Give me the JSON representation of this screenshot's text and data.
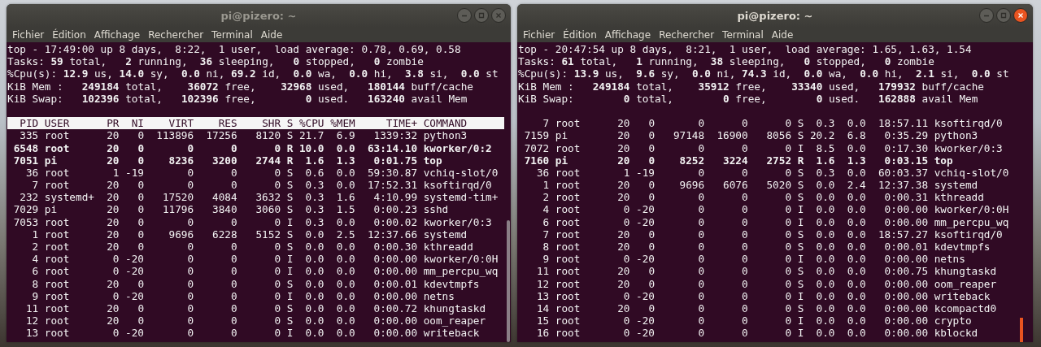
{
  "windows": [
    {
      "title": "pi@pizero: ~",
      "active": false,
      "menu": [
        "Fichier",
        "Édition",
        "Affichage",
        "Rechercher",
        "Terminal",
        "Aide"
      ],
      "summary": [
        "top - 17:49:00 up 8 days,  8:22,  1 user,  load average: 0.78, 0.69, 0.58",
        "Tasks: **59** total,   **2** running,  **36** sleeping,   **0** stopped,   **0** zombie",
        "%Cpu(s): **12.9** us, **14.0** sy,  **0.0** ni, **69.2** id,  **0.0** wa,  **0.0** hi,  **3.8** si,  **0.0** st",
        "KiB Mem :   **249184** total,    **36072** free,    **32968** used,   **180144** buff/cache",
        "KiB Swap:   **102396** total,   **102396** free,        **0** used.   **163240** avail Mem"
      ],
      "columns": [
        "PID",
        "USER",
        "PR",
        "NI",
        "VIRT",
        "RES",
        "SHR",
        "S",
        "%CPU",
        "%MEM",
        "TIME+",
        "COMMAND"
      ],
      "rows": [
        {
          "bold": false,
          "cells": [
            "335",
            "root",
            "20",
            "0",
            "113896",
            "17256",
            "8120",
            "S",
            "21.7",
            "6.9",
            "1339:32",
            "python3"
          ]
        },
        {
          "bold": true,
          "cells": [
            "6548",
            "root",
            "20",
            "0",
            "0",
            "0",
            "0",
            "R",
            "10.0",
            "0.0",
            "63:14.10",
            "kworker/0:2"
          ]
        },
        {
          "bold": true,
          "cells": [
            "7051",
            "pi",
            "20",
            "0",
            "8236",
            "3200",
            "2744",
            "R",
            "1.6",
            "1.3",
            "0:01.75",
            "top"
          ]
        },
        {
          "bold": false,
          "cells": [
            "36",
            "root",
            "1",
            "-19",
            "0",
            "0",
            "0",
            "S",
            "0.6",
            "0.0",
            "59:30.87",
            "vchiq-slot/0"
          ]
        },
        {
          "bold": false,
          "cells": [
            "7",
            "root",
            "20",
            "0",
            "0",
            "0",
            "0",
            "S",
            "0.3",
            "0.0",
            "17:52.31",
            "ksoftirqd/0"
          ]
        },
        {
          "bold": false,
          "cells": [
            "232",
            "systemd+",
            "20",
            "0",
            "17520",
            "4084",
            "3632",
            "S",
            "0.3",
            "1.6",
            "4:10.99",
            "systemd-tim+"
          ]
        },
        {
          "bold": false,
          "cells": [
            "7029",
            "pi",
            "20",
            "0",
            "11796",
            "3840",
            "3060",
            "S",
            "0.3",
            "1.5",
            "0:00.23",
            "sshd"
          ]
        },
        {
          "bold": false,
          "cells": [
            "7053",
            "root",
            "20",
            "0",
            "0",
            "0",
            "0",
            "I",
            "0.3",
            "0.0",
            "0:00.02",
            "kworker/0:3"
          ]
        },
        {
          "bold": false,
          "cells": [
            "1",
            "root",
            "20",
            "0",
            "9696",
            "6228",
            "5152",
            "S",
            "0.0",
            "2.5",
            "12:37.66",
            "systemd"
          ]
        },
        {
          "bold": false,
          "cells": [
            "2",
            "root",
            "20",
            "0",
            "0",
            "0",
            "0",
            "S",
            "0.0",
            "0.0",
            "0:00.30",
            "kthreadd"
          ]
        },
        {
          "bold": false,
          "cells": [
            "4",
            "root",
            "0",
            "-20",
            "0",
            "0",
            "0",
            "I",
            "0.0",
            "0.0",
            "0:00.00",
            "kworker/0:0H"
          ]
        },
        {
          "bold": false,
          "cells": [
            "6",
            "root",
            "0",
            "-20",
            "0",
            "0",
            "0",
            "I",
            "0.0",
            "0.0",
            "0:00.00",
            "mm_percpu_wq"
          ]
        },
        {
          "bold": false,
          "cells": [
            "8",
            "root",
            "20",
            "0",
            "0",
            "0",
            "0",
            "S",
            "0.0",
            "0.0",
            "0:00.01",
            "kdevtmpfs"
          ]
        },
        {
          "bold": false,
          "cells": [
            "9",
            "root",
            "0",
            "-20",
            "0",
            "0",
            "0",
            "I",
            "0.0",
            "0.0",
            "0:00.00",
            "netns"
          ]
        },
        {
          "bold": false,
          "cells": [
            "11",
            "root",
            "20",
            "0",
            "0",
            "0",
            "0",
            "S",
            "0.0",
            "0.0",
            "0:00.72",
            "khungtaskd"
          ]
        },
        {
          "bold": false,
          "cells": [
            "12",
            "root",
            "20",
            "0",
            "0",
            "0",
            "0",
            "S",
            "0.0",
            "0.0",
            "0:00.00",
            "oom_reaper"
          ]
        },
        {
          "bold": false,
          "cells": [
            "13",
            "root",
            "0",
            "-20",
            "0",
            "0",
            "0",
            "I",
            "0.0",
            "0.0",
            "0:00.00",
            "writeback"
          ]
        }
      ]
    },
    {
      "title": "pi@pizero: ~",
      "active": true,
      "menu": [
        "Fichier",
        "Édition",
        "Affichage",
        "Rechercher",
        "Terminal",
        "Aide"
      ],
      "summary": [
        "top - 20:47:54 up 8 days,  8:21,  1 user,  load average: 1.65, 1.63, 1.54",
        "Tasks: **61** total,   **1** running,  **38** sleeping,   **0** stopped,   **0** zombie",
        "%Cpu(s): **13.9** us,  **9.6** sy,  **0.0** ni, **74.3** id,  **0.0** wa,  **0.0** hi,  **2.1** si,  **0.0** st",
        "KiB Mem :   **249184** total,    **35912** free,    **33340** used,   **179932** buff/cache",
        "KiB Swap:        **0** total,        **0** free,        **0** used.   **162888** avail Mem"
      ],
      "rows": [
        {
          "bold": false,
          "cells": [
            "7",
            "root",
            "20",
            "0",
            "0",
            "0",
            "0",
            "S",
            "0.3",
            "0.0",
            "18:57.11",
            "ksoftirqd/0"
          ]
        },
        {
          "bold": false,
          "cells": [
            "7159",
            "pi",
            "20",
            "0",
            "97148",
            "16900",
            "8056",
            "S",
            "20.2",
            "6.8",
            "0:35.29",
            "python3"
          ]
        },
        {
          "bold": false,
          "cells": [
            "7072",
            "root",
            "20",
            "0",
            "0",
            "0",
            "0",
            "I",
            "8.5",
            "0.0",
            "0:17.30",
            "kworker/0:3"
          ]
        },
        {
          "bold": true,
          "cells": [
            "7160",
            "pi",
            "20",
            "0",
            "8252",
            "3224",
            "2752",
            "R",
            "1.6",
            "1.3",
            "0:03.15",
            "top"
          ]
        },
        {
          "bold": false,
          "cells": [
            "36",
            "root",
            "1",
            "-19",
            "0",
            "0",
            "0",
            "S",
            "0.3",
            "0.0",
            "60:03.37",
            "vchiq-slot/0"
          ]
        },
        {
          "bold": false,
          "cells": [
            "1",
            "root",
            "20",
            "0",
            "9696",
            "6076",
            "5020",
            "S",
            "0.0",
            "2.4",
            "12:37.38",
            "systemd"
          ]
        },
        {
          "bold": false,
          "cells": [
            "2",
            "root",
            "20",
            "0",
            "0",
            "0",
            "0",
            "S",
            "0.0",
            "0.0",
            "0:00.31",
            "kthreadd"
          ]
        },
        {
          "bold": false,
          "cells": [
            "4",
            "root",
            "0",
            "-20",
            "0",
            "0",
            "0",
            "I",
            "0.0",
            "0.0",
            "0:00.00",
            "kworker/0:0H"
          ]
        },
        {
          "bold": false,
          "cells": [
            "6",
            "root",
            "0",
            "-20",
            "0",
            "0",
            "0",
            "I",
            "0.0",
            "0.0",
            "0:00.00",
            "mm_percpu_wq"
          ]
        },
        {
          "bold": false,
          "cells": [
            "7",
            "root",
            "20",
            "0",
            "0",
            "0",
            "0",
            "S",
            "0.0",
            "0.0",
            "18:57.27",
            "ksoftirqd/0"
          ]
        },
        {
          "bold": false,
          "cells": [
            "8",
            "root",
            "20",
            "0",
            "0",
            "0",
            "0",
            "S",
            "0.0",
            "0.0",
            "0:00.01",
            "kdevtmpfs"
          ]
        },
        {
          "bold": false,
          "cells": [
            "9",
            "root",
            "0",
            "-20",
            "0",
            "0",
            "0",
            "I",
            "0.0",
            "0.0",
            "0:00.00",
            "netns"
          ]
        },
        {
          "bold": false,
          "cells": [
            "11",
            "root",
            "20",
            "0",
            "0",
            "0",
            "0",
            "S",
            "0.0",
            "0.0",
            "0:00.75",
            "khungtaskd"
          ]
        },
        {
          "bold": false,
          "cells": [
            "12",
            "root",
            "20",
            "0",
            "0",
            "0",
            "0",
            "S",
            "0.0",
            "0.0",
            "0:00.00",
            "oom_reaper"
          ]
        },
        {
          "bold": false,
          "cells": [
            "13",
            "root",
            "0",
            "-20",
            "0",
            "0",
            "0",
            "I",
            "0.0",
            "0.0",
            "0:00.00",
            "writeback"
          ]
        },
        {
          "bold": false,
          "cells": [
            "14",
            "root",
            "20",
            "0",
            "0",
            "0",
            "0",
            "S",
            "0.0",
            "0.0",
            "0:00.00",
            "kcompactd0"
          ]
        },
        {
          "bold": false,
          "cells": [
            "15",
            "root",
            "0",
            "-20",
            "0",
            "0",
            "0",
            "I",
            "0.0",
            "0.0",
            "0:00.00",
            "crypto"
          ]
        },
        {
          "bold": false,
          "cells": [
            "16",
            "root",
            "0",
            "-20",
            "0",
            "0",
            "0",
            "I",
            "0.0",
            "0.0",
            "0:00.00",
            "kblockd"
          ]
        }
      ]
    }
  ]
}
